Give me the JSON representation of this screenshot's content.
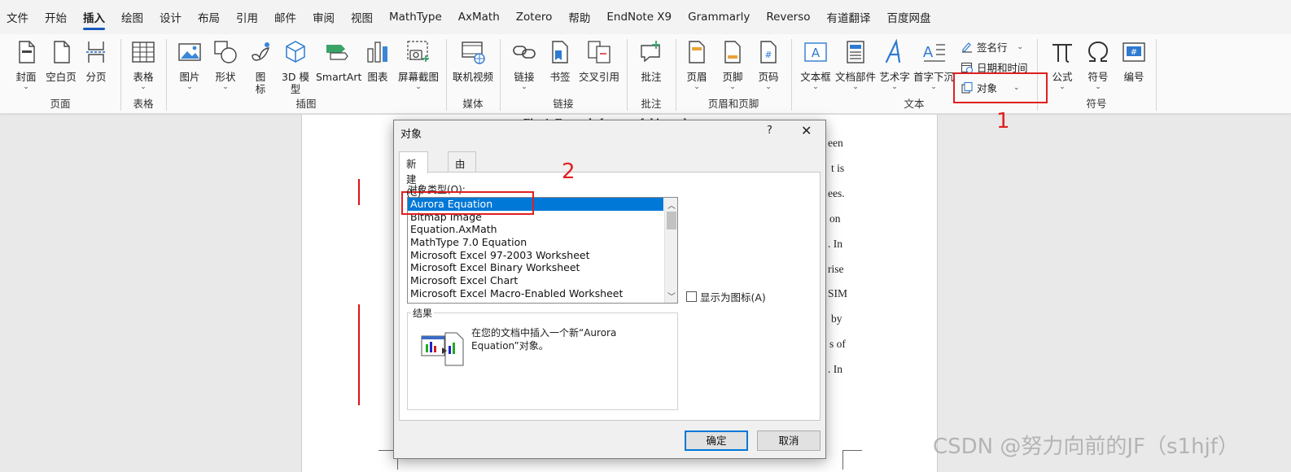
{
  "menu": {
    "items": [
      "文件",
      "开始",
      "插入",
      "绘图",
      "设计",
      "布局",
      "引用",
      "邮件",
      "审阅",
      "视图",
      "MathType",
      "AxMath",
      "Zotero",
      "帮助",
      "EndNote X9",
      "Grammarly",
      "Reverso",
      "有道翻译",
      "百度网盘"
    ],
    "active_index": 2
  },
  "ribbon": {
    "pages": {
      "label": "页面",
      "cover": "封面",
      "blank": "空白页",
      "pagebreak": "分页"
    },
    "tables": {
      "label": "表格",
      "table": "表格"
    },
    "illustrations": {
      "label": "插图",
      "picture": "图片",
      "shapes": "形状",
      "icons_l1": "图",
      "icons_l2": "标",
      "model_l1": "3D 模",
      "model_l2": "型",
      "smartart": "SmartArt",
      "chart": "图表",
      "screenshot": "屏幕截图"
    },
    "media": {
      "label": "媒体",
      "online_video": "联机视频"
    },
    "links": {
      "label": "链接",
      "link": "链接",
      "bookmark": "书签",
      "crossref": "交叉引用"
    },
    "comments": {
      "label": "批注",
      "comment": "批注"
    },
    "header_footer": {
      "label": "页眉和页脚",
      "header": "页眉",
      "footer": "页脚",
      "page_number": "页码"
    },
    "text": {
      "label": "文本",
      "textbox": "文本框",
      "quickparts": "文档部件",
      "wordart": "艺术字",
      "dropcap": "首字下沉",
      "signature": "签名行",
      "datetime": "日期和时间",
      "object": "对象"
    },
    "symbols": {
      "label": "符号",
      "equation": "公式",
      "symbol": "符号",
      "numbering": "编号"
    }
  },
  "document": {
    "heading_fragment": "Fig. 1. Example frames of this study",
    "right_fragments": [
      "een",
      "t is",
      "ees.",
      "on",
      ". In",
      "rise",
      "SIM",
      "by",
      "s of",
      ". In"
    ]
  },
  "dialog": {
    "title": "对象",
    "help": "?",
    "close": "✕",
    "tabs": [
      "新建(C)",
      "由文件创建(F)"
    ],
    "object_type_label": "对象类型(O):",
    "object_types": [
      "Aurora Equation",
      "Bitmap Image",
      "Equation.AxMath",
      "MathType 7.0 Equation",
      "Microsoft Excel 97-2003 Worksheet",
      "Microsoft Excel Binary Worksheet",
      "Microsoft Excel Chart",
      "Microsoft Excel Macro-Enabled Worksheet"
    ],
    "selected_index": 0,
    "display_as_icon": "显示为图标(A)",
    "result_label": "结果",
    "result_text": "在您的文档中插入一个新“Aurora Equation”对象。",
    "ok": "确定",
    "cancel": "取消"
  },
  "annotations": {
    "num1": "1",
    "num2": "2",
    "color": "#e02020"
  },
  "watermark": "CSDN @努力向前的JF（s1hjf）",
  "colors": {
    "accent": "#185abd",
    "selection": "#0078d7"
  }
}
